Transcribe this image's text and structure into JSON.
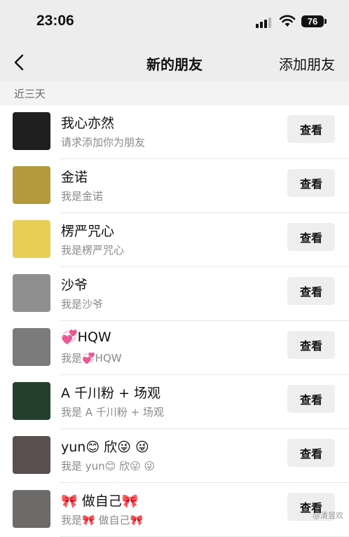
{
  "status_bar": {
    "time": "23:06",
    "battery": "76"
  },
  "nav": {
    "title": "新的朋友",
    "action": "添加朋友"
  },
  "section_label": "近三天",
  "view_label": "查看",
  "requests": [
    {
      "name": "我心亦然",
      "message": "请求添加你为朋友",
      "avatar_color": "#1f1f1f"
    },
    {
      "name": "金诺",
      "message": "我是金诺",
      "avatar_color": "#b49a3c"
    },
    {
      "name": "楞严咒心",
      "message": "我是楞严咒心",
      "avatar_color": "#e7cf55"
    },
    {
      "name": "沙爷",
      "message": "我是沙爷",
      "avatar_color": "#8f8f8f"
    },
    {
      "name": "💞HQW",
      "message": "我是💞HQW",
      "avatar_color": "#7b7b7b"
    },
    {
      "name": "A 千川粉 + 场观",
      "message": "我是 A 千川粉 + 场观",
      "avatar_color": "#23402c"
    },
    {
      "name": "yun😊 欣😜 😜",
      "message": "我是 yun😊 欣😜 😜",
      "avatar_color": "#5a4f4f"
    },
    {
      "name": "🎀 做自己🎀",
      "message": "我是🎀 做自己🎀",
      "avatar_color": "#6d6a6a"
    }
  ],
  "watermark": "@清昱欢"
}
